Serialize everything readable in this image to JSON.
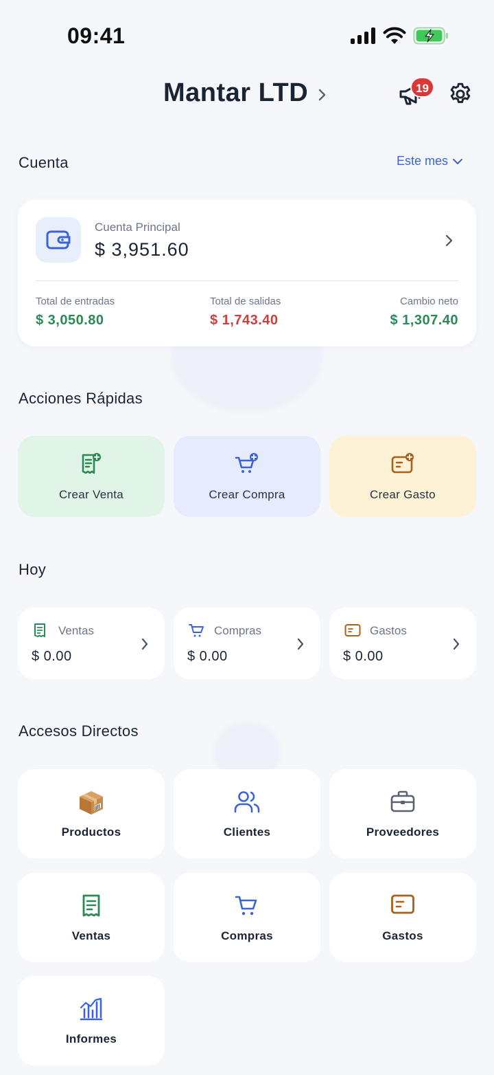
{
  "status_bar": {
    "time": "09:41"
  },
  "header": {
    "company": "Mantar LTD",
    "notifications_count": "19"
  },
  "account_section": {
    "title": "Cuenta",
    "period": "Este mes",
    "account": {
      "label": "Cuenta Principal",
      "balance": "$ 3,951.60",
      "stats": [
        {
          "label": "Total de entradas",
          "value": "$ 3,050.80"
        },
        {
          "label": "Total de salidas",
          "value": "$ 1,743.40"
        },
        {
          "label": "Cambio neto",
          "value": "$ 1,307.40"
        }
      ]
    }
  },
  "quick_actions": {
    "title": "Acciones Rápidas",
    "items": [
      {
        "label": "Crear Venta",
        "icon": "receipt-plus-icon"
      },
      {
        "label": "Crear Compra",
        "icon": "cart-plus-icon"
      },
      {
        "label": "Crear Gasto",
        "icon": "expense-plus-icon"
      }
    ]
  },
  "today": {
    "title": "Hoy",
    "items": [
      {
        "label": "Ventas",
        "value": "$ 0.00",
        "icon": "receipt-icon"
      },
      {
        "label": "Compras",
        "value": "$ 0.00",
        "icon": "cart-icon"
      },
      {
        "label": "Gastos",
        "value": "$ 0.00",
        "icon": "expense-icon"
      }
    ]
  },
  "shortcuts": {
    "title": "Accesos Directos",
    "items": [
      {
        "label": "Productos",
        "icon": "package-icon"
      },
      {
        "label": "Clientes",
        "icon": "users-icon"
      },
      {
        "label": "Proveedores",
        "icon": "briefcase-icon"
      },
      {
        "label": "Ventas",
        "icon": "receipt-icon"
      },
      {
        "label": "Compras",
        "icon": "cart-icon"
      },
      {
        "label": "Gastos",
        "icon": "expense-icon"
      },
      {
        "label": "Informes",
        "icon": "chart-icon"
      }
    ]
  },
  "colors": {
    "accent_blue": "#3b63d9",
    "green": "#2a8a55",
    "red": "#d23c3c",
    "amber": "#a9601a",
    "badge": "#d93838"
  }
}
